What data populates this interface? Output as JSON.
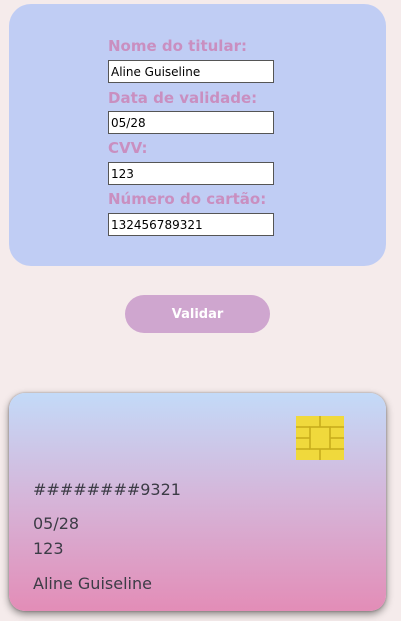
{
  "form": {
    "holder_label": "Nome do titular:",
    "holder_value": "Aline Guiseline",
    "expiry_label": "Data de validade:",
    "expiry_value": "05/28",
    "cvv_label": "CVV:",
    "cvv_value": "123",
    "number_label": "Número do cartão:",
    "number_value": "132456789321",
    "submit_label": "Validar"
  },
  "card": {
    "chip_icon": "sim-chip-icon",
    "masked_number": "########9321",
    "expiry": "05/28",
    "cvv": "123",
    "holder_name": "Aline Guiseline"
  },
  "colors": {
    "page_background": "#f5ebeb",
    "form_panel": "#c0cdf4",
    "label_text": "#c98fc0",
    "button": "#cfa6cf",
    "card_gradient_top": "#c3daf8",
    "card_gradient_bottom": "#e38db7",
    "chip": "#f0d93c"
  }
}
